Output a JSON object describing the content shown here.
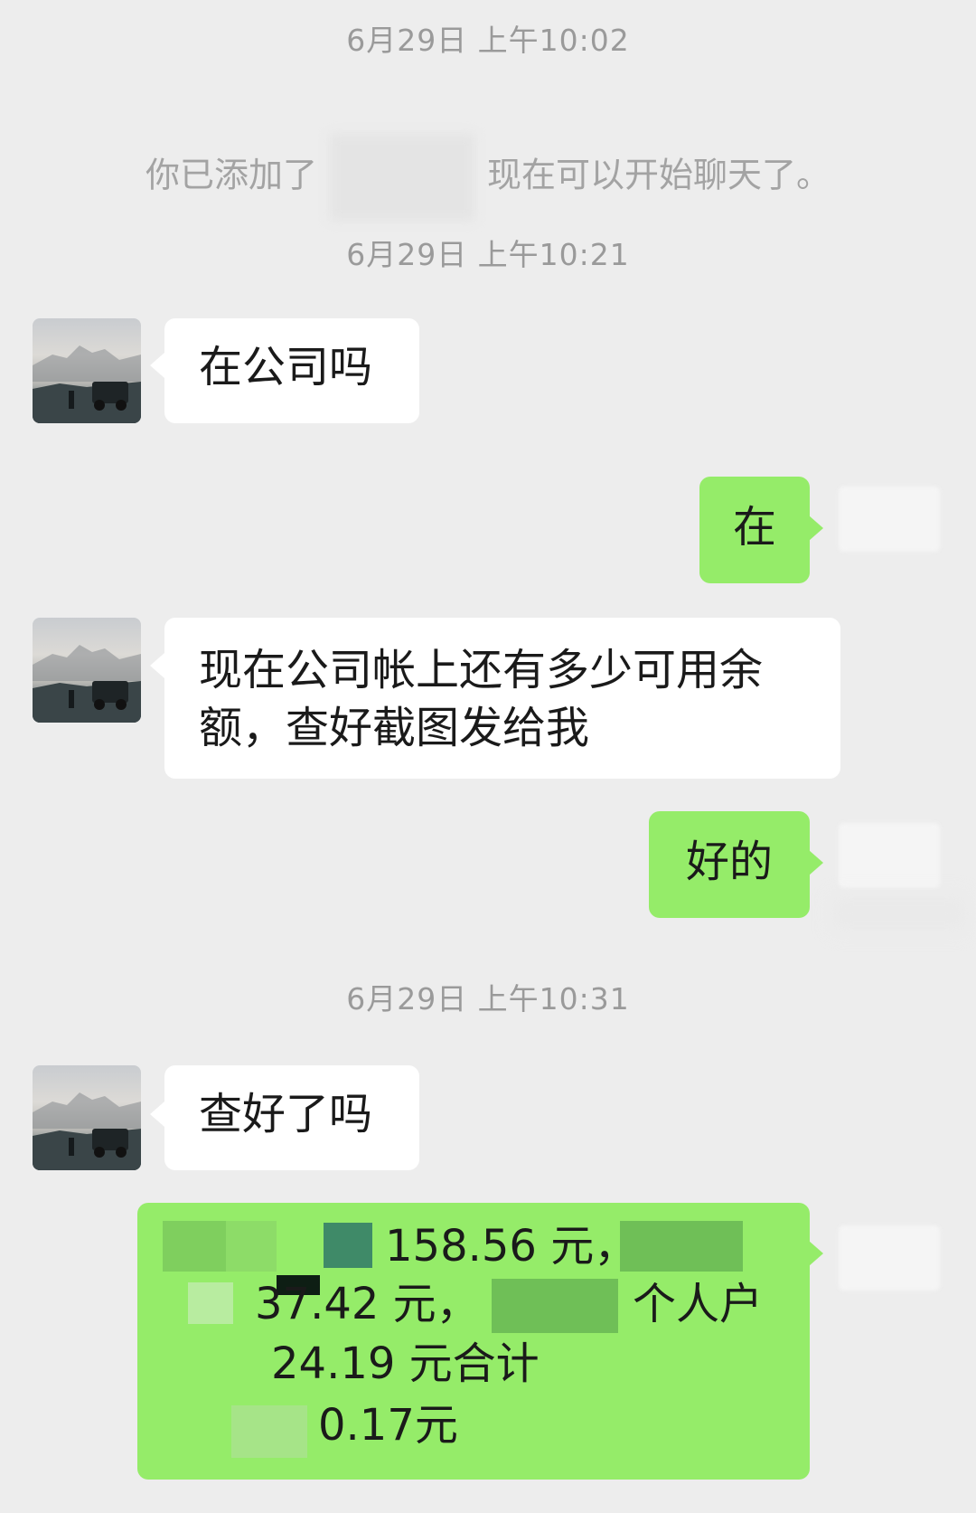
{
  "timestamps": [
    "6月29日 上午10:02",
    "6月29日 上午10:21",
    "6月29日 上午10:31"
  ],
  "system_message": {
    "prefix": "你已添加了",
    "suffix": "现在可以开始聊天了。"
  },
  "messages": [
    {
      "from": "contact",
      "text": "在公司吗"
    },
    {
      "from": "me",
      "text": "在"
    },
    {
      "from": "contact",
      "lines": [
        "现在公司帐上还有多少可用余",
        "额，查好截图发给我"
      ]
    },
    {
      "from": "me",
      "text": "好的"
    },
    {
      "from": "contact",
      "text": "查好了吗"
    },
    {
      "from": "me",
      "lines": [
        "158.56 元，",
        "37.42 元，",
        "个人户",
        "24.19 元合计",
        "0.17元"
      ]
    }
  ],
  "colors": {
    "background": "#ededed",
    "bubble_left": "#ffffff",
    "bubble_right": "#95ec69",
    "timestamp_text": "#9a9a9a"
  },
  "icons": {
    "contact_avatar": "landscape-avatar-icon",
    "my_avatar": "blurred-avatar-icon"
  }
}
